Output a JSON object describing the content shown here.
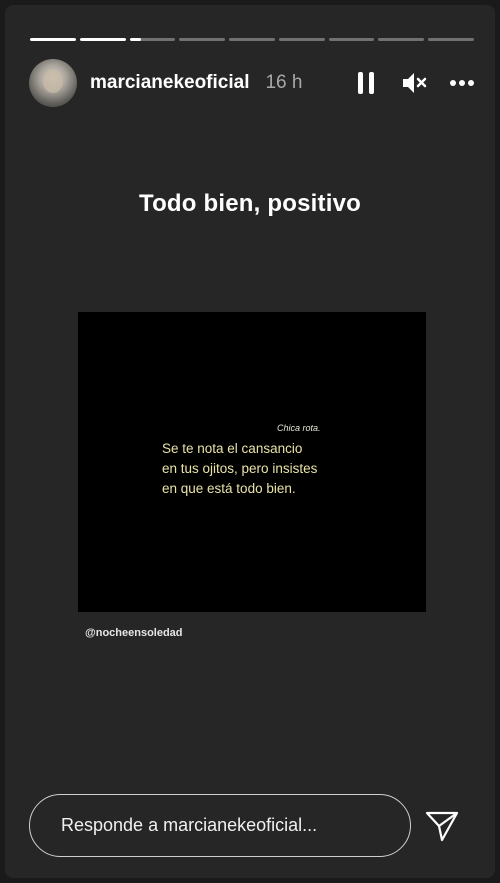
{
  "story": {
    "progress": [
      1,
      1,
      0.25,
      0,
      0,
      0,
      0,
      0,
      0
    ],
    "user": {
      "username": "marcianekeoficial",
      "time": "16 h"
    },
    "icons": {
      "pause": "pause-icon",
      "mute": "speaker-muted-icon",
      "more": "more-options-icon",
      "send": "send-icon"
    },
    "heading": "Todo bien, positivo",
    "media": {
      "small_caption": "Chica rota.",
      "lines": [
        "Se te nota el cansancio",
        "en tus ojitos, pero insistes",
        "en que está todo bien."
      ],
      "credit": "@nocheensoledad"
    },
    "reply_placeholder": "Responde a marcianekeoficial..."
  }
}
